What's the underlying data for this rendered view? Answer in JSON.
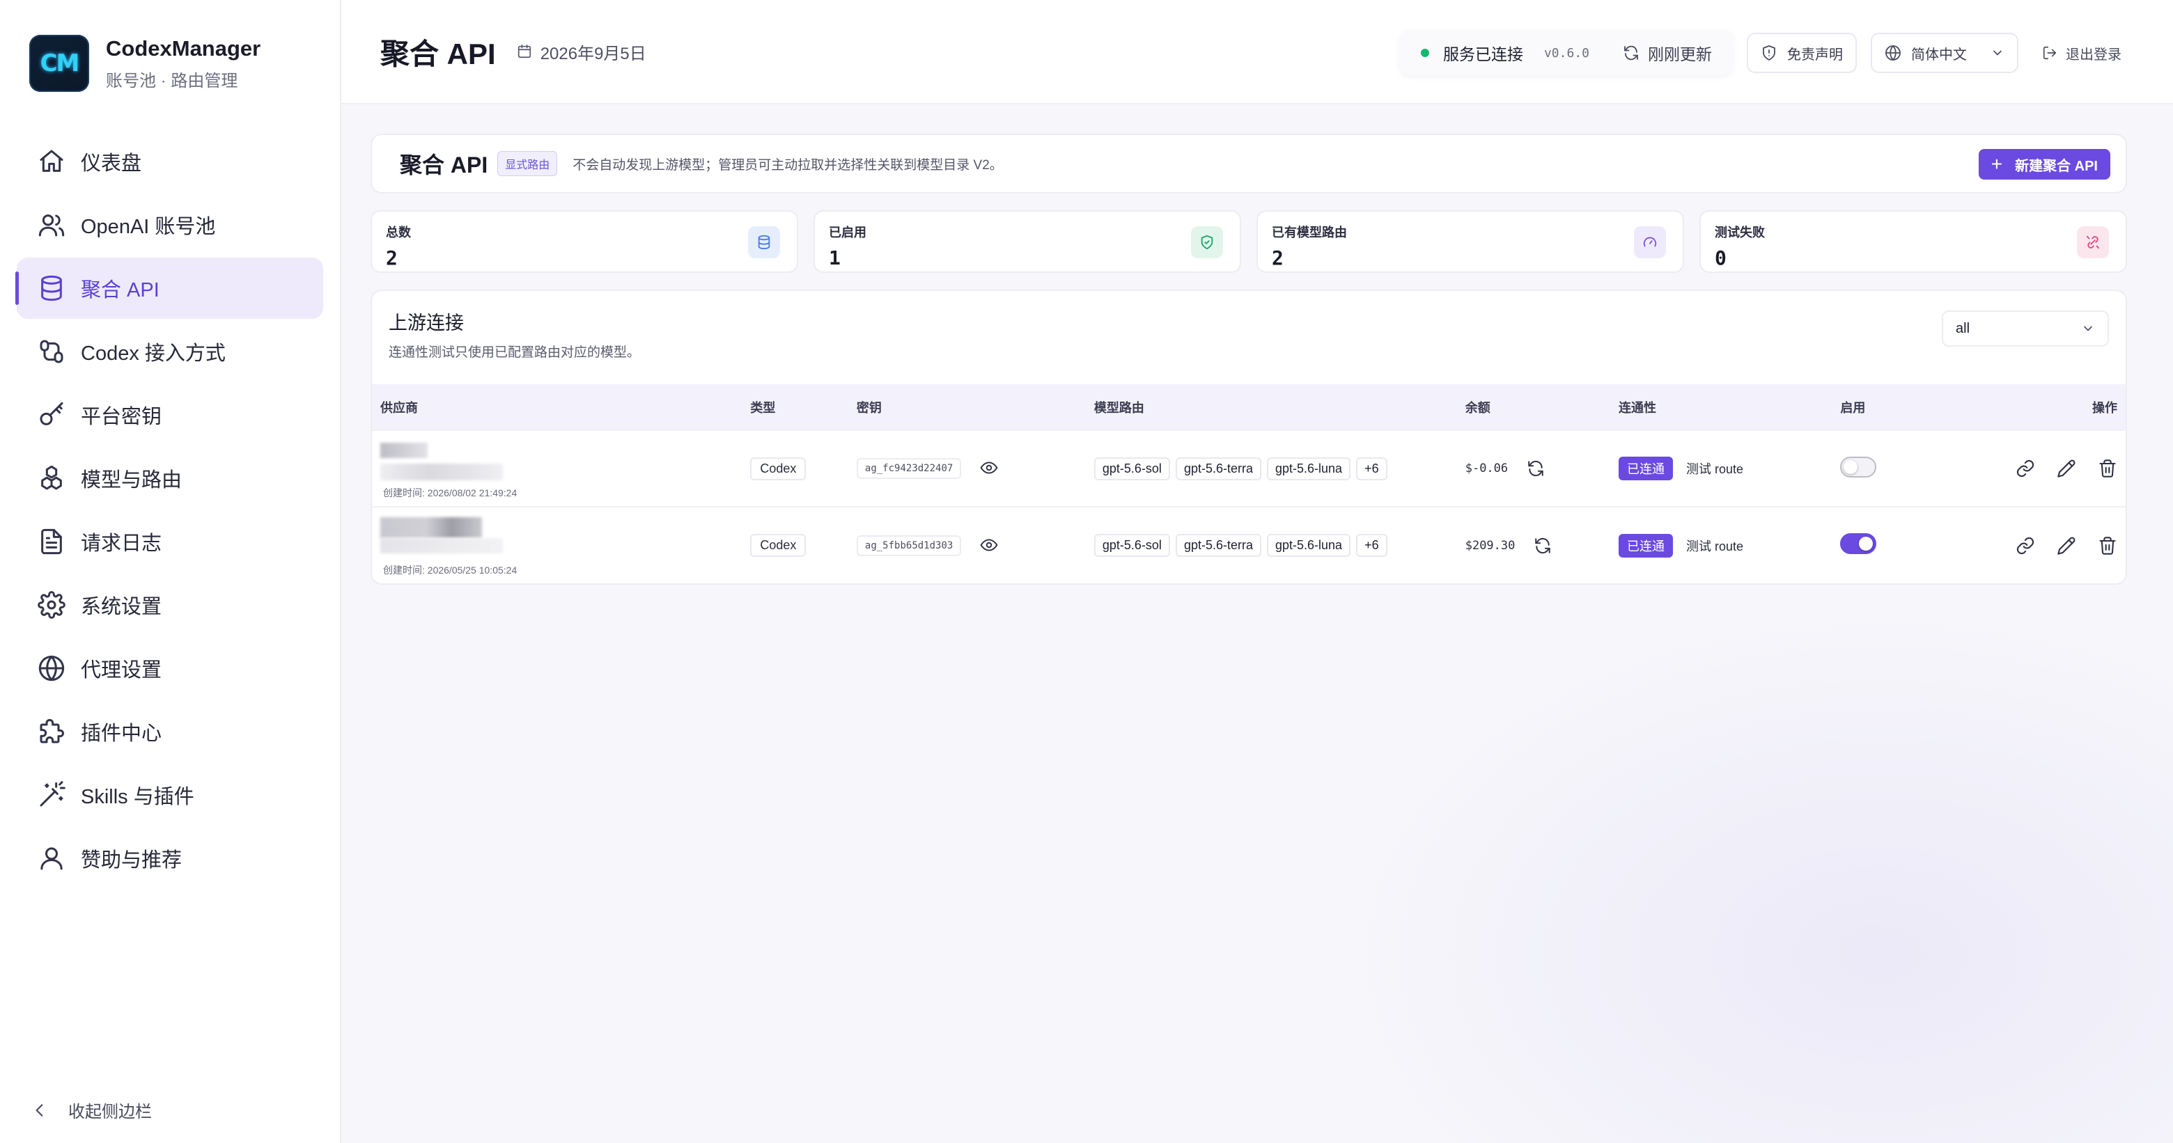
{
  "brand": {
    "logo_text": "CM",
    "name": "CodexManager",
    "subtitle": "账号池 · 路由管理"
  },
  "nav": {
    "items": [
      {
        "label": "仪表盘",
        "icon": "home-icon"
      },
      {
        "label": "OpenAI 账号池",
        "icon": "users-icon"
      },
      {
        "label": "聚合 API",
        "icon": "database-icon",
        "active": true
      },
      {
        "label": "Codex 接入方式",
        "icon": "route-icon"
      },
      {
        "label": "平台密钥",
        "icon": "key-icon"
      },
      {
        "label": "模型与路由",
        "icon": "boxes-icon"
      },
      {
        "label": "请求日志",
        "icon": "file-text-icon"
      },
      {
        "label": "系统设置",
        "icon": "gear-icon"
      },
      {
        "label": "代理设置",
        "icon": "globe-icon"
      },
      {
        "label": "插件中心",
        "icon": "puzzle-icon"
      },
      {
        "label": "Skills 与插件",
        "icon": "magic-wand-icon"
      },
      {
        "label": "赞助与推荐",
        "icon": "user-icon"
      }
    ],
    "collapse_label": "收起侧边栏"
  },
  "header": {
    "title": "聚合 API",
    "date": "2026年9月5日",
    "status": "服务已连接",
    "version": "v0.6.0",
    "refresh": "刚刚更新",
    "disclaimer": "免责声明",
    "language": "简体中文",
    "logout": "退出登录"
  },
  "hero": {
    "title": "聚合 API",
    "badge": "显式路由",
    "description": "不会自动发现上游模型；管理员可主动拉取并选择性关联到模型目录 V2。",
    "new_button": "新建聚合 API"
  },
  "stats": [
    {
      "label": "总数",
      "value": "2",
      "icon": "database-icon",
      "color": "#4a7be0",
      "bg": "#e6eefc"
    },
    {
      "label": "已启用",
      "value": "1",
      "icon": "shield-check-icon",
      "color": "#1ea56b",
      "bg": "#e2f5ec"
    },
    {
      "label": "已有模型路由",
      "value": "2",
      "icon": "gauge-icon",
      "color": "#7a55d8",
      "bg": "#efeafb"
    },
    {
      "label": "测试失败",
      "value": "0",
      "icon": "unlink-icon",
      "color": "#e0457a",
      "bg": "#fce6ee"
    }
  ],
  "upstream": {
    "title": "上游连接",
    "subtitle": "连通性测试只使用已配置路由对应的模型。",
    "filter": "all",
    "columns": [
      "供应商",
      "类型",
      "密钥",
      "模型路由",
      "余额",
      "连通性",
      "启用",
      "操作"
    ],
    "rows": [
      {
        "created": "创建时间: 2026/08/02 21:49:24",
        "type": "Codex",
        "key": "ag_fc9423d22407",
        "models": [
          "gpt-5.6-sol",
          "gpt-5.6-terra",
          "gpt-5.6-luna",
          "+6"
        ],
        "balance": "$-0.06",
        "connectivity": "已连通",
        "test": "测试 route",
        "enabled": false
      },
      {
        "created": "创建时间: 2026/05/25 10:05:24",
        "type": "Codex",
        "key": "ag_5fbb65d1d303",
        "models": [
          "gpt-5.6-sol",
          "gpt-5.6-terra",
          "gpt-5.6-luna",
          "+6"
        ],
        "balance": "$209.30",
        "connectivity": "已连通",
        "test": "测试 route",
        "enabled": true
      }
    ]
  }
}
